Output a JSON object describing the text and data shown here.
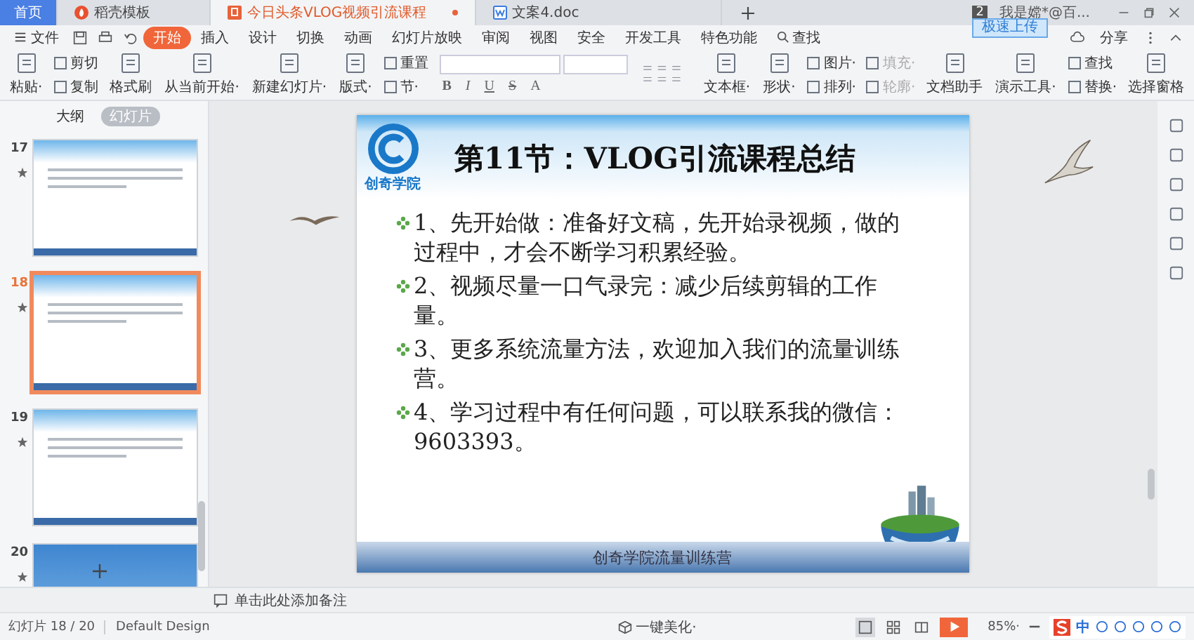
{
  "title_tabs": [
    {
      "label": "首页",
      "kind": "home",
      "selected": false
    },
    {
      "label": "稻壳模板",
      "kind": "template",
      "selected": false
    },
    {
      "label": "今日头条VLOG视频引流课程",
      "kind": "slides",
      "selected": true
    },
    {
      "label": "文案4.doc",
      "kind": "doc",
      "selected": false
    }
  ],
  "window_badge": "2",
  "user": "我是嫦*@百...",
  "upload_button": "极速上传",
  "file_menu": "文件",
  "menu_tabs": [
    {
      "label": "开始",
      "selected": true
    },
    {
      "label": "插入",
      "selected": false
    },
    {
      "label": "设计",
      "selected": false
    },
    {
      "label": "切换",
      "selected": false
    },
    {
      "label": "动画",
      "selected": false
    },
    {
      "label": "幻灯片放映",
      "selected": false
    },
    {
      "label": "审阅",
      "selected": false
    },
    {
      "label": "视图",
      "selected": false
    },
    {
      "label": "安全",
      "selected": false
    },
    {
      "label": "开发工具",
      "selected": false
    },
    {
      "label": "特色功能",
      "selected": false
    }
  ],
  "search": "查找",
  "share": "分享",
  "ribbon_left": [
    {
      "kind": "large",
      "label": "粘贴·"
    },
    {
      "kind": "pair",
      "labels": [
        "剪切",
        "复制"
      ]
    },
    {
      "kind": "large",
      "label": "格式刷"
    },
    {
      "kind": "large",
      "label": "从当前开始·"
    },
    {
      "kind": "large",
      "label": "新建幻灯片·"
    },
    {
      "kind": "large",
      "label": "版式·"
    },
    {
      "kind": "pair",
      "labels": [
        "重置",
        "节·"
      ]
    }
  ],
  "format_buttons": [
    "B",
    "I",
    "U",
    "S",
    "A"
  ],
  "ribbon_right": [
    {
      "kind": "large",
      "label": "文本框·"
    },
    {
      "kind": "large",
      "label": "形状·"
    },
    {
      "kind": "pair",
      "labels": [
        "图片·",
        "排列·"
      ]
    },
    {
      "kind": "pair",
      "labels": [
        "填充·",
        "轮廓·"
      ],
      "disabled": true
    },
    {
      "kind": "large",
      "label": "文档助手"
    },
    {
      "kind": "large",
      "label": "演示工具·"
    },
    {
      "kind": "pair",
      "labels": [
        "查找",
        "替换·"
      ]
    },
    {
      "kind": "large",
      "label": "选择窗格"
    }
  ],
  "outline_tabs": [
    {
      "label": "大纲",
      "selected": false
    },
    {
      "label": "幻灯片",
      "selected": true
    }
  ],
  "slides": [
    {
      "number": "17",
      "kind": "text",
      "selected": false
    },
    {
      "number": "18",
      "kind": "text",
      "selected": true
    },
    {
      "number": "19",
      "kind": "text",
      "selected": false
    },
    {
      "number": "20",
      "kind": "map",
      "selected": false
    }
  ],
  "slide": {
    "logo": "创奇学院",
    "title": "第11节：VLOG引流课程总结",
    "bullets": [
      "1、先开始做：准备好文稿，先开始录视频，做的过程中，才会不断学习积累经验。",
      "2、视频尽量一口气录完：减少后续剪辑的工作量。",
      "3、更多系统流量方法，欢迎加入我们的流量训练营。",
      "4、学习过程中有任何问题，可以联系我的微信：9603393。"
    ],
    "footer": "创奇学院流量训练营"
  },
  "notes_placeholder": "单击此处添加备注",
  "status": {
    "slide_counter": "幻灯片 18 / 20",
    "theme": "Default Design",
    "beautify": "一键美化·",
    "zoom": "85%·",
    "ime": "中"
  },
  "views": [
    {
      "kind": "normal",
      "selected": true
    },
    {
      "kind": "sorter",
      "selected": false
    },
    {
      "kind": "reading",
      "selected": false
    }
  ]
}
